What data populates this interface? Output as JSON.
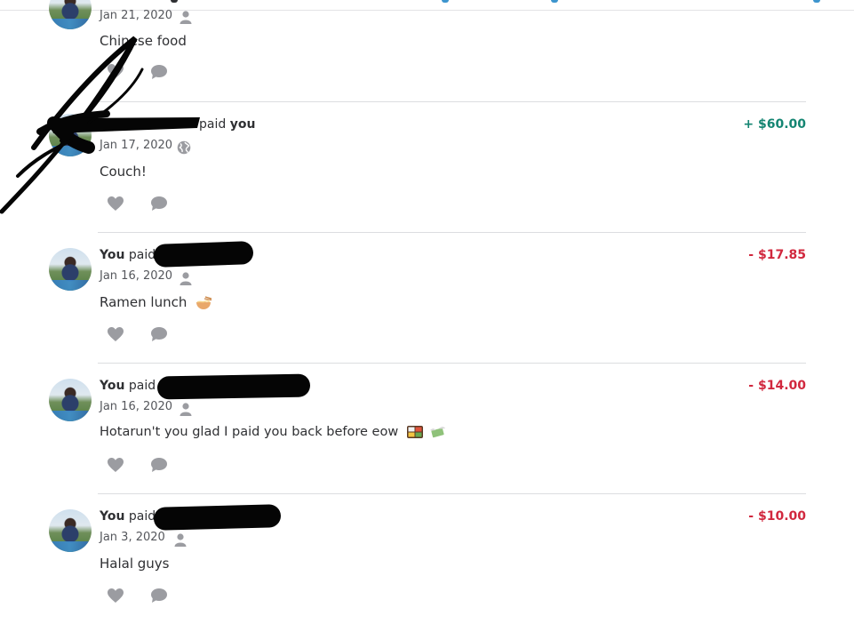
{
  "feed": {
    "stories": [
      {
        "title_prefix": "",
        "title_verb": "",
        "title_suffix": "",
        "amount": "",
        "date": "Jan 21, 2020",
        "audience_icon": "person-icon",
        "note": "Chinese food"
      },
      {
        "title_prefix": "",
        "title_verb": "paid",
        "title_suffix": "you",
        "amount": "+ $60.00",
        "date": "Jan 17, 2020",
        "audience_icon": "globe-icon",
        "note": "Couch!"
      },
      {
        "title_prefix": "You",
        "title_verb": "paid",
        "title_suffix": "",
        "amount": "- $17.85",
        "date": "Jan 16, 2020",
        "audience_icon": "person-icon",
        "note": "Ramen lunch"
      },
      {
        "title_prefix": "You",
        "title_verb": "paid",
        "title_suffix": "",
        "amount": "- $14.00",
        "date": "Jan 16, 2020",
        "audience_icon": "person-icon",
        "note": "Hotarun't you glad I paid you back before eow"
      },
      {
        "title_prefix": "You",
        "title_verb": "paid",
        "title_suffix": "",
        "amount": "- $10.00",
        "date": "Jan 3, 2020",
        "audience_icon": "person-icon",
        "note": "Halal guys"
      }
    ]
  },
  "icons": {
    "like": "heart-icon",
    "comment": "comment-icon",
    "private": "person-icon",
    "public": "globe-icon"
  },
  "colors": {
    "incoming": "#148572",
    "outgoing": "#d1283e",
    "icon_gray": "#9b9ca1"
  }
}
